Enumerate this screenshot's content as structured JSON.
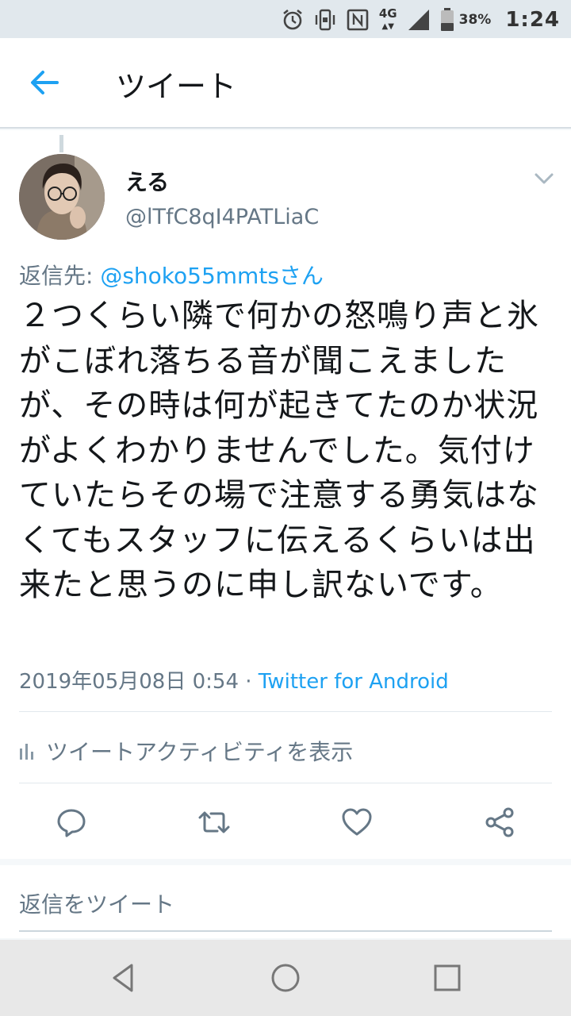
{
  "status_bar": {
    "network": "4G",
    "battery_percent": "38%",
    "time": "1:24",
    "icons": [
      "alarm-icon",
      "vibrate-icon",
      "nfc-icon",
      "signal-icon",
      "battery-icon"
    ]
  },
  "app_bar": {
    "title": "ツイート",
    "back_icon": "arrow-left-icon"
  },
  "tweet": {
    "author_name": "える",
    "author_handle": "@lTfC8qI4PATLiaC",
    "reply_prefix": "返信先:",
    "reply_mention": "@shoko55mmtsさん",
    "text": "２つくらい隣で何かの怒鳴り声と氷がこぼれ落ちる音が聞こえましたが、その時は何が起きてたのか状況がよくわかりませんでした。気付けていたらその場で注意する勇気はなくてもスタッフに伝えるくらいは出来たと思うのに申し訳ないです。",
    "timestamp": "2019年05月08日 0:54",
    "separator": "·",
    "source": "Twitter for Android",
    "activity_label": "ツイートアクティビティを表示",
    "actions": [
      "reply-icon",
      "retweet-icon",
      "like-icon",
      "share-icon"
    ]
  },
  "reply_box": {
    "placeholder": "返信をツイート"
  },
  "nav_bar": {
    "buttons": [
      "back-triangle-icon",
      "home-circle-icon",
      "recents-square-icon"
    ]
  },
  "colors": {
    "accent": "#1da1f2",
    "secondary_text": "#657786",
    "status_bar_bg": "#e1e8ed",
    "page_bg": "#f5f8fa"
  }
}
